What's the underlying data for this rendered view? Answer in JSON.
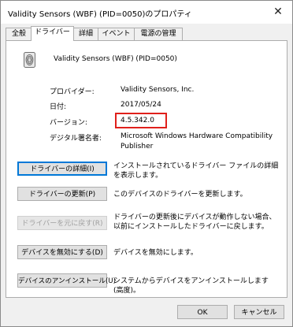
{
  "window": {
    "title": "Validity Sensors (WBF) (PID=0050)のプロパティ",
    "close_glyph": "✕"
  },
  "tabs": [
    {
      "label": "全般",
      "active": false
    },
    {
      "label": "ドライバー",
      "active": true
    },
    {
      "label": "詳細",
      "active": false
    },
    {
      "label": "イベント",
      "active": false
    },
    {
      "label": "電源の管理",
      "active": false
    }
  ],
  "device": {
    "icon": "fingerprint-sensor-icon",
    "name": "Validity Sensors (WBF) (PID=0050)"
  },
  "info": [
    {
      "label": "プロバイダー:",
      "value": "Validity Sensors, Inc."
    },
    {
      "label": "日付:",
      "value": "2017/05/24"
    },
    {
      "label": "バージョン:",
      "value": "4.5.342.0"
    },
    {
      "label": "デジタル署名者:",
      "value": "Microsoft Windows Hardware Compatibility Publisher"
    }
  ],
  "highlight_color": "#e0201b",
  "actions": [
    {
      "label": "ドライバーの詳細(I)",
      "description": "インストールされているドライバー ファイルの詳細を表示します。",
      "enabled": true
    },
    {
      "label": "ドライバーの更新(P)",
      "description": "このデバイスのドライバーを更新します。",
      "enabled": true
    },
    {
      "label": "ドライバーを元に戻す(R)",
      "description": "ドライバーの更新後にデバイスが動作しない場合、以前にインストールしたドライバーに戻します。",
      "enabled": false
    },
    {
      "label": "デバイスを無効にする(D)",
      "description": "デバイスを無効にします。",
      "enabled": true
    },
    {
      "label": "デバイスのアンインストール(U)",
      "description": "システムからデバイスをアンインストールします (高度)。",
      "enabled": true
    }
  ],
  "footer": {
    "ok_label": "OK",
    "cancel_label": "キャンセル"
  }
}
